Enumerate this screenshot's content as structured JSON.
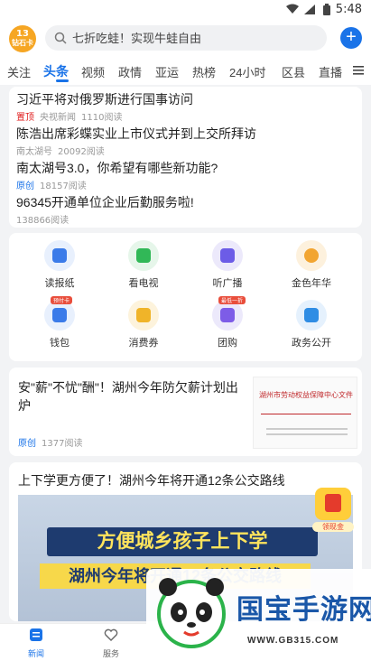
{
  "status_bar": {
    "time": "5:48"
  },
  "header": {
    "logo_line1": "13",
    "logo_line2": "钻石卡",
    "search_placeholder": "七折吃蛙！实现牛蛙自由",
    "add_label": "+"
  },
  "tabs": [
    "关注",
    "头条",
    "视频",
    "政情",
    "亚运",
    "热榜",
    "24小时",
    "区县",
    "直播"
  ],
  "active_tab": "头条",
  "headlines": [
    {
      "title": "习近平将对俄罗斯进行国事访问",
      "tag": "置顶",
      "source": "央视新闻",
      "reads": "1110阅读"
    },
    {
      "title": "陈浩出席彩蝶实业上市仪式并到上交所拜访",
      "tag": "",
      "source": "南太湖号",
      "reads": "20092阅读"
    },
    {
      "title": "南太湖号3.0，你希望有哪些新功能?",
      "tag": "原创",
      "source": "",
      "reads": "18157阅读"
    },
    {
      "title": "96345开通单位企业后勤服务啦!",
      "tag": "",
      "source": "",
      "reads": "138866阅读"
    }
  ],
  "services": [
    {
      "label": "读报纸",
      "icon": "newspaper-icon",
      "bg": "#e8f0fd",
      "fg": "#3b7be9"
    },
    {
      "label": "看电视",
      "icon": "tv-icon",
      "bg": "#e6f6ea",
      "fg": "#31b857"
    },
    {
      "label": "听广播",
      "icon": "radio-icon",
      "bg": "#ece9fb",
      "fg": "#6c5ce7"
    },
    {
      "label": "金色年华",
      "icon": "lion-icon",
      "bg": "#fdf1dd",
      "fg": "#f2a531"
    },
    {
      "label": "钱包",
      "icon": "wallet-icon",
      "bg": "#e8f0fd",
      "fg": "#3b7be9",
      "badge": "预付卡"
    },
    {
      "label": "消费券",
      "icon": "voucher-icon",
      "bg": "#fdf3dc",
      "fg": "#f0b429"
    },
    {
      "label": "团购",
      "icon": "group-buy-icon",
      "bg": "#ece9fb",
      "fg": "#7d5ce7",
      "badge": "最低一折"
    },
    {
      "label": "政务公开",
      "icon": "government-icon",
      "bg": "#e5f1fd",
      "fg": "#2f8de4"
    }
  ],
  "feature_article": {
    "title": "安\"薪\"不忧\"酬\"！湖州今年防欠薪计划出炉",
    "tag": "原创",
    "reads": "1377阅读",
    "thumb_title": "湖州市劳动权益保障中心文件"
  },
  "video_article": {
    "title": "上下学更方便了！湖州今年将开通12条公交路线",
    "banner_line1": "方便城乡孩子上下学",
    "banner_line2": "湖州今年将开通12条公交路线",
    "coupon_label": "领现金"
  },
  "bottom_nav": [
    {
      "label": "新闻",
      "icon": "news-icon"
    },
    {
      "label": "服务",
      "icon": "heart-icon"
    }
  ],
  "watermark": {
    "name": "国宝手游网",
    "url": "WWW.GB315.COM"
  }
}
